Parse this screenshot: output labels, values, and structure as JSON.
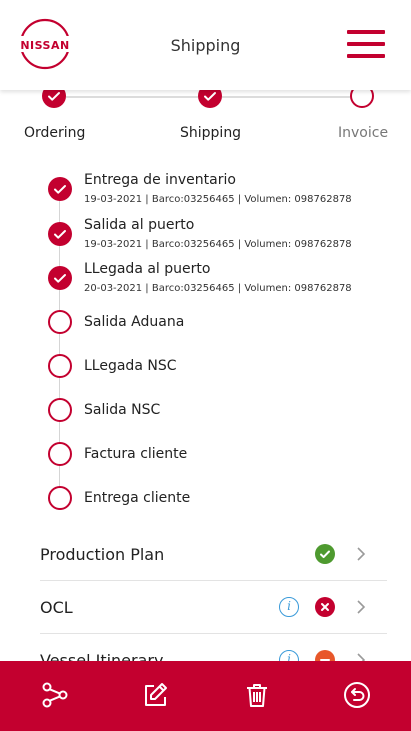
{
  "header": {
    "brand": "NISSAN",
    "title": "Shipping"
  },
  "stepper": {
    "steps": [
      {
        "label": "Ordering",
        "state": "done"
      },
      {
        "label": "Shipping",
        "state": "done"
      },
      {
        "label": "Invoice",
        "state": "pending"
      }
    ]
  },
  "timeline": {
    "items": [
      {
        "title": "Entrega de inventario",
        "meta": "19-03-2021 | Barco:03256465 | Volumen: 098762878",
        "state": "done"
      },
      {
        "title": "Salida al puerto",
        "meta": "19-03-2021 | Barco:03256465 | Volumen: 098762878",
        "state": "done"
      },
      {
        "title": "LLegada al puerto",
        "meta": "20-03-2021 | Barco:03256465 | Volumen: 098762878",
        "state": "done"
      },
      {
        "title": "Salida Aduana",
        "meta": "",
        "state": "pending"
      },
      {
        "title": "LLegada NSC",
        "meta": "",
        "state": "pending"
      },
      {
        "title": "Salida NSC",
        "meta": "",
        "state": "pending"
      },
      {
        "title": "Factura cliente",
        "meta": "",
        "state": "pending"
      },
      {
        "title": "Entrega cliente",
        "meta": "",
        "state": "pending"
      }
    ]
  },
  "documents": [
    {
      "label": "Production Plan",
      "info": false,
      "status": "ok",
      "status_color": "#4e9a2f"
    },
    {
      "label": "OCL",
      "info": true,
      "status": "error",
      "status_color": "#c3002f"
    },
    {
      "label": "Vessel Itinerary",
      "info": true,
      "status": "warning",
      "status_color": "#e8572a"
    }
  ],
  "bottom_bar": {
    "actions": [
      "share-icon",
      "edit-icon",
      "trash-icon",
      "undo-icon"
    ]
  },
  "colors": {
    "brand": "#c3002f",
    "ok": "#4e9a2f",
    "info": "#3a9ad9"
  }
}
